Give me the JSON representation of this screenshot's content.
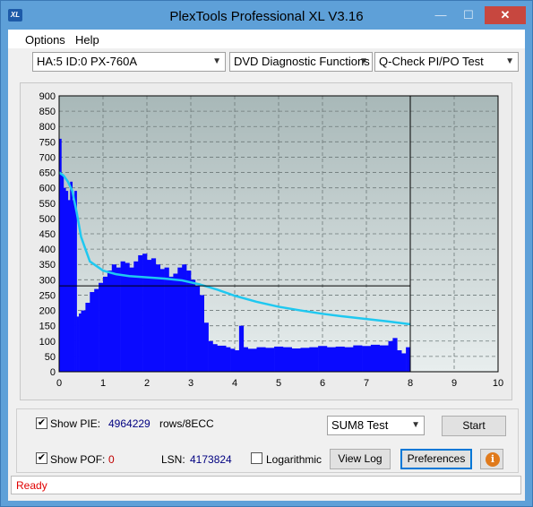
{
  "window": {
    "title": "PlexTools Professional XL V3.16",
    "app_icon": "XL",
    "minimize_icon": "—",
    "maximize_icon": "☐",
    "close_icon": "✕"
  },
  "menu": {
    "options": "Options",
    "help": "Help"
  },
  "toolbar": {
    "drive": "HA:5 ID:0  PX-760A",
    "function": "DVD Diagnostic Functions",
    "test": "Q-Check PI/PO Test"
  },
  "controls": {
    "show_pie_label": "Show PIE:",
    "show_pie_checked": true,
    "pie_value": "4964229",
    "pie_units": "rows/8ECC",
    "sum8_select": "SUM8 Test",
    "start_button": "Start",
    "show_pof_label": "Show POF:",
    "show_pof_checked": true,
    "pof_value": "0",
    "lsn_label": "LSN:",
    "lsn_value": "4173824",
    "logarithmic_label": "Logarithmic",
    "logarithmic_checked": false,
    "view_log_button": "View Log",
    "preferences_button": "Preferences",
    "info_icon": "i"
  },
  "status": {
    "text": "Ready"
  },
  "colors": {
    "plot_bg_top": "#a8b8b8",
    "plot_bg_bottom": "#e8eeee",
    "bars": "#0a0aff",
    "curve": "#1fc8f0"
  },
  "chart_data": {
    "type": "bar",
    "title": "",
    "xlabel": "",
    "ylabel": "",
    "xlim": [
      0,
      10
    ],
    "ylim": [
      0,
      900
    ],
    "x_ticks": [
      "0",
      "1",
      "2",
      "3",
      "4",
      "5",
      "6",
      "7",
      "8",
      "9",
      "10"
    ],
    "y_ticks": [
      "0",
      "50",
      "100",
      "150",
      "200",
      "250",
      "300",
      "350",
      "400",
      "450",
      "500",
      "550",
      "600",
      "650",
      "700",
      "750",
      "800",
      "850",
      "900"
    ],
    "grid": true,
    "marker_x": 8.0,
    "marker_y": 280,
    "series": [
      {
        "kind": "bars",
        "x": [
          0.0,
          0.05,
          0.1,
          0.15,
          0.2,
          0.25,
          0.3,
          0.35,
          0.4,
          0.45,
          0.5,
          0.6,
          0.7,
          0.8,
          0.9,
          1.0,
          1.1,
          1.2,
          1.3,
          1.4,
          1.5,
          1.6,
          1.7,
          1.8,
          1.9,
          2.0,
          2.1,
          2.2,
          2.3,
          2.4,
          2.5,
          2.6,
          2.7,
          2.8,
          2.9,
          3.0,
          3.1,
          3.2,
          3.3,
          3.4,
          3.5,
          3.6,
          3.8,
          3.9,
          4.0,
          4.1,
          4.2,
          4.3,
          4.5,
          4.7,
          4.9,
          5.1,
          5.3,
          5.5,
          5.7,
          5.9,
          6.1,
          6.3,
          6.5,
          6.7,
          6.9,
          7.1,
          7.3,
          7.5,
          7.6,
          7.7,
          7.8,
          7.9
        ],
        "values": [
          760,
          640,
          600,
          590,
          560,
          620,
          560,
          590,
          180,
          190,
          200,
          225,
          260,
          270,
          290,
          310,
          330,
          350,
          340,
          360,
          355,
          340,
          360,
          380,
          385,
          365,
          370,
          350,
          335,
          340,
          310,
          320,
          340,
          350,
          330,
          300,
          280,
          250,
          160,
          100,
          90,
          85,
          80,
          75,
          70,
          150,
          80,
          75,
          80,
          78,
          82,
          80,
          76,
          78,
          80,
          84,
          80,
          82,
          80,
          86,
          84,
          88,
          86,
          100,
          110,
          70,
          60,
          80
        ]
      },
      {
        "kind": "line",
        "x": [
          0.0,
          0.1,
          0.2,
          0.3,
          0.4,
          0.5,
          0.7,
          1.0,
          1.3,
          1.6,
          2.0,
          2.4,
          2.8,
          3.2,
          3.6,
          4.0,
          4.5,
          5.0,
          5.5,
          6.0,
          6.5,
          7.0,
          7.5,
          8.0
        ],
        "values": [
          650,
          640,
          620,
          590,
          520,
          440,
          360,
          330,
          318,
          312,
          308,
          304,
          298,
          285,
          268,
          248,
          228,
          212,
          200,
          189,
          180,
          172,
          164,
          155
        ]
      }
    ]
  }
}
